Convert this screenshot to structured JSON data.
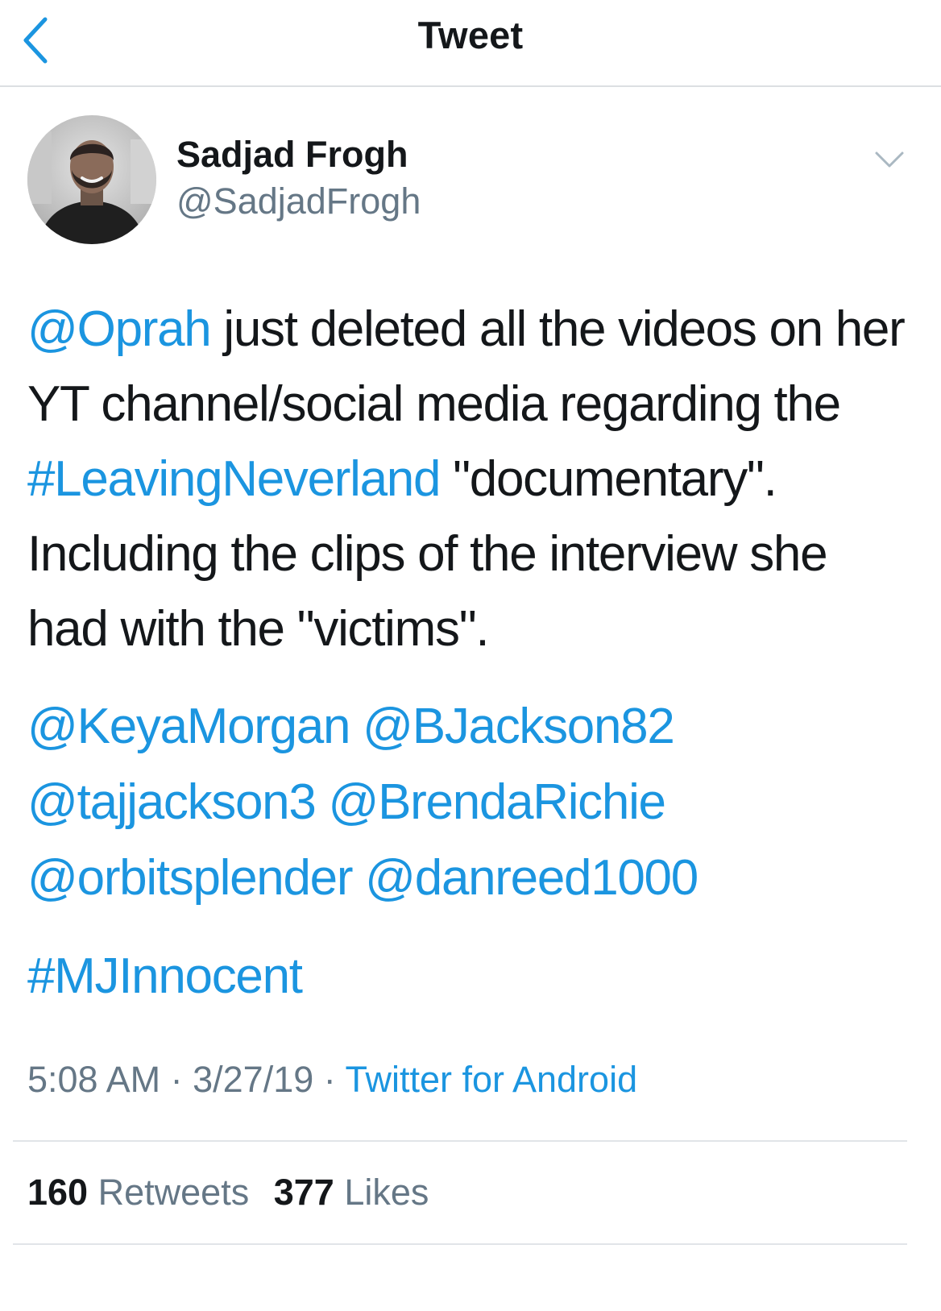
{
  "nav": {
    "title": "Tweet",
    "back_icon": "chevron-left-icon"
  },
  "author": {
    "display_name": "Sadjad Frogh",
    "handle": "@SadjadFrogh",
    "avatar_icon": "profile-photo",
    "menu_icon": "chevron-down-icon"
  },
  "tweet": {
    "line1_mention": "@Oprah",
    "line1_text": " just deleted all the videos on her YT channel/social media regarding the ",
    "hashtag_leaving": "#LeavingNeverland",
    "line1_tail": " \"documentary\". Including the clips of the interview she had with the \"victims\".",
    "mentions": [
      "@KeyaMorgan",
      "@BJackson82",
      "@tajjackson3",
      "@BrendaRichie",
      "@orbitsplender",
      "@danreed1000"
    ],
    "hashtag_final": "#MJInnocent"
  },
  "meta": {
    "time": "5:08 AM",
    "separator1": " · ",
    "date": "3/27/19",
    "separator2": " · ",
    "source": "Twitter for Android"
  },
  "stats": {
    "retweets_count": "160",
    "retweets_label": "Retweets",
    "likes_count": "377",
    "likes_label": "Likes"
  },
  "colors": {
    "link": "#1b95e0",
    "text": "#14171a",
    "secondary": "#657786"
  }
}
